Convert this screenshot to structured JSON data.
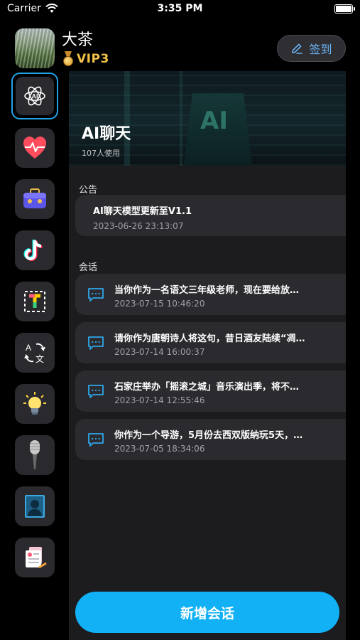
{
  "status_bar": {
    "carrier": "Carrier",
    "time": "3:35 PM"
  },
  "header": {
    "username": "大茶",
    "vip": "VIP3",
    "signin_label": "签到"
  },
  "sidebar": {
    "items": [
      {
        "icon": "ai-chat-icon",
        "active": true
      },
      {
        "icon": "health-icon"
      },
      {
        "icon": "briefcase-icon"
      },
      {
        "icon": "tiktok-icon"
      },
      {
        "icon": "text-extract-icon"
      },
      {
        "icon": "translate-icon"
      },
      {
        "icon": "idea-bulb-icon"
      },
      {
        "icon": "microphone-icon"
      },
      {
        "icon": "portrait-icon"
      },
      {
        "icon": "document-icon"
      }
    ]
  },
  "banner": {
    "title": "AI聊天",
    "users": "107人使用",
    "image_text": "AI"
  },
  "notice": {
    "section_label": "公告",
    "title": "AI聊天模型更新至V1.1",
    "time": "2023-06-26 23:13:07"
  },
  "conversations": {
    "section_label": "会话",
    "items": [
      {
        "title": "当你作为一名语文三年级老师，现在要给放…",
        "time": "2023-07-15 10:46:20"
      },
      {
        "title": "请你作为唐朝诗人将这句，昔日酒友陆续“凋…",
        "time": "2023-07-14 16:00:37"
      },
      {
        "title": "石家庄举办「摇滚之城」音乐演出季，将不…",
        "time": "2023-07-14 12:55:46"
      },
      {
        "title": "你作为一个导游，5月份去西双版纳玩5天，…",
        "time": "2023-07-05 18:34:06"
      }
    ]
  },
  "new_conversation_label": "新增会话",
  "colors": {
    "accent": "#12b1f5",
    "vip_gold": "#f2c24a",
    "card": "#2b2b2f",
    "panel": "#1c1c1f"
  }
}
